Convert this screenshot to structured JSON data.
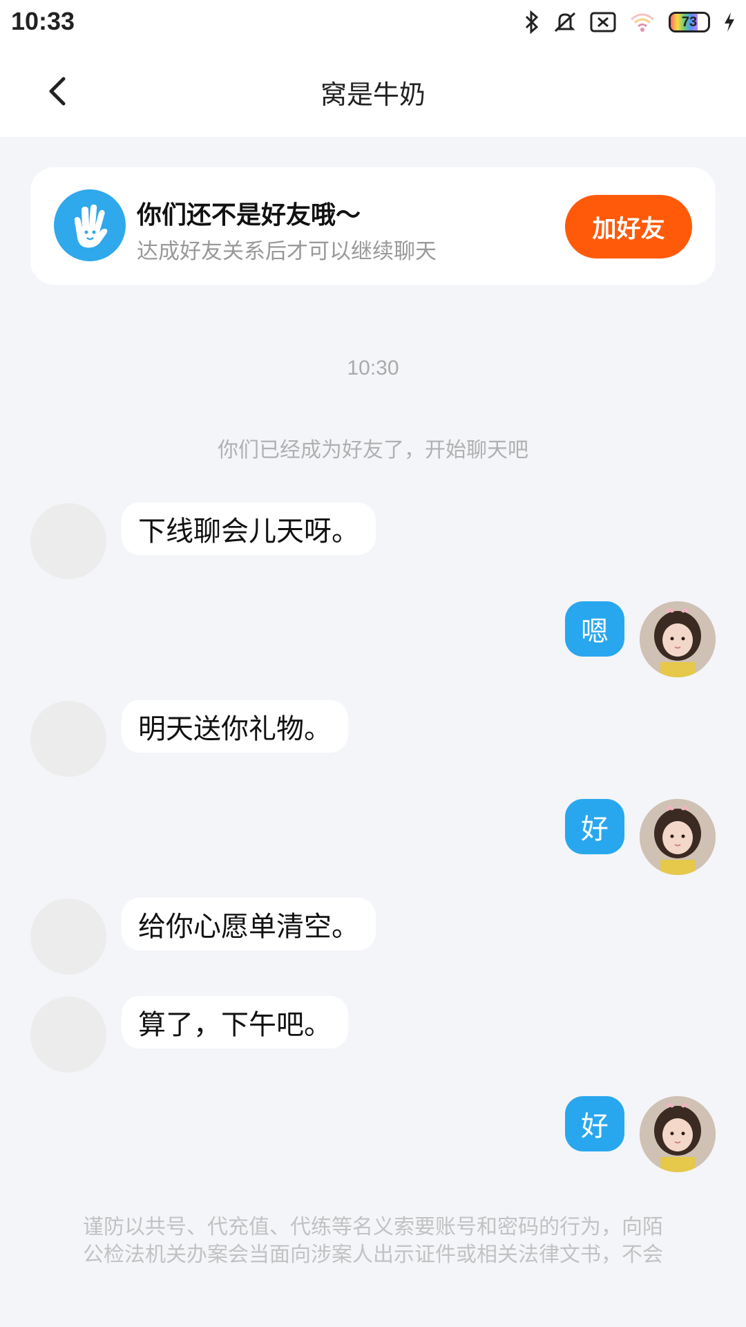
{
  "status_bar": {
    "time": "10:33",
    "battery": "73"
  },
  "header": {
    "title": "窝是牛奶"
  },
  "friend_card": {
    "title": "你们还不是好友哦～",
    "subtitle": "达成好友关系后才可以继续聊天",
    "add_button": "加好友"
  },
  "chat": {
    "time_label": "10:30",
    "system_message": "你们已经成为好友了，开始聊天吧",
    "messages": [
      {
        "side": "left",
        "text": "下线聊会儿天呀。"
      },
      {
        "side": "right",
        "text": "嗯"
      },
      {
        "side": "left",
        "text": "明天送你礼物。"
      },
      {
        "side": "right",
        "text": "好"
      },
      {
        "side": "left",
        "text": "给你心愿单清空。"
      },
      {
        "side": "left",
        "text": "算了，下午吧。"
      },
      {
        "side": "right",
        "text": "好"
      }
    ]
  },
  "disclaimer": {
    "line1": "谨防以共号、代充值、代练等名义索要账号和密码的行为，向陌",
    "line2": "公检法机关办案会当面向涉案人出示证件或相关法律文书，不会"
  }
}
